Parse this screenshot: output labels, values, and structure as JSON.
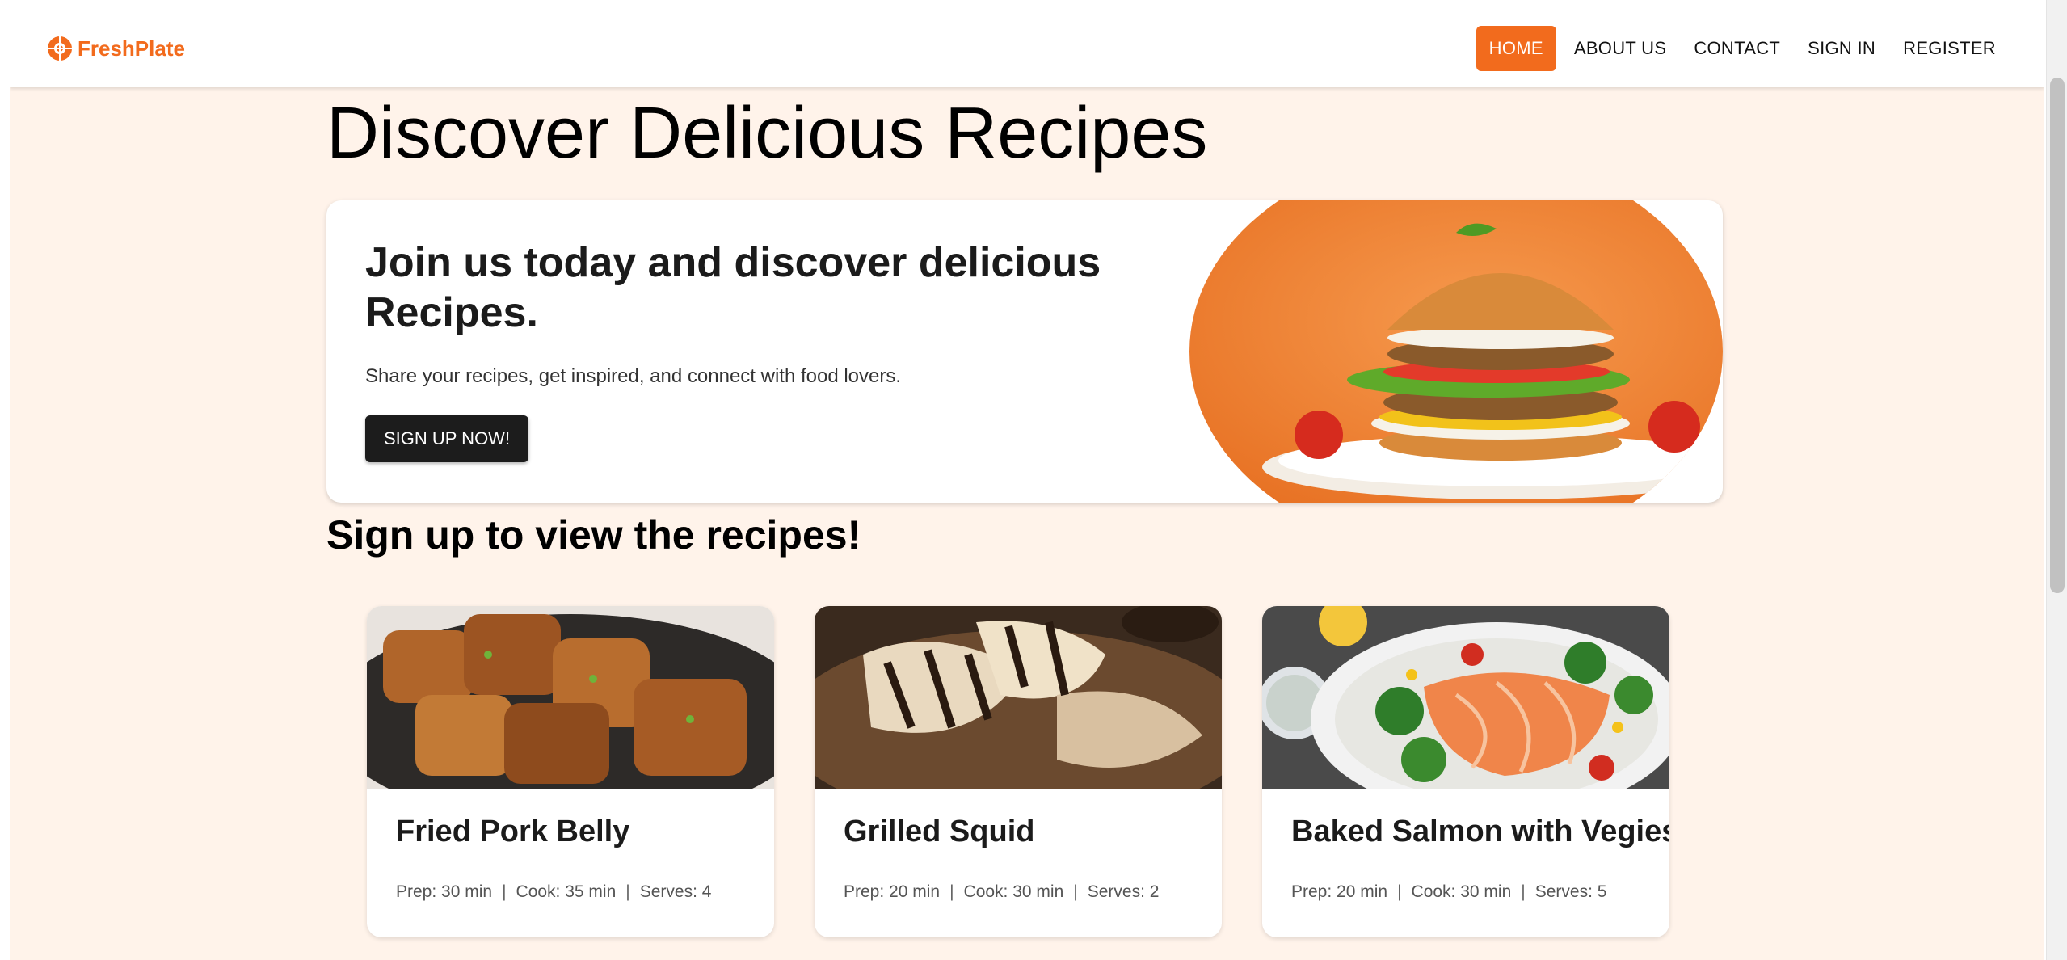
{
  "brand": {
    "name": "FreshPlate",
    "accent": "#f26b1d",
    "logo_icon": "plate-logo-icon"
  },
  "nav": {
    "items": [
      {
        "label": "HOME",
        "active": true
      },
      {
        "label": "ABOUT US",
        "active": false
      },
      {
        "label": "CONTACT",
        "active": false
      },
      {
        "label": "SIGN IN",
        "active": false
      },
      {
        "label": "REGISTER",
        "active": false
      }
    ]
  },
  "hero": {
    "title": "Discover Delicious Recipes",
    "heading": "Join us today and discover delicious Recipes.",
    "subtext": "Share your recipes, get inspired, and connect with food lovers.",
    "cta_label": "SIGN UP NOW!",
    "image": "burger-image"
  },
  "recipes_section": {
    "title": "Sign up to view the recipes!"
  },
  "recipes": [
    {
      "title": "Fried Pork Belly",
      "prep": "Prep: 30 min",
      "cook": "Cook: 35 min",
      "serves": "Serves: 4",
      "image": "fried-pork-belly-image"
    },
    {
      "title": "Grilled Squid",
      "prep": "Prep: 20 min",
      "cook": "Cook: 30 min",
      "serves": "Serves: 2",
      "image": "grilled-squid-image"
    },
    {
      "title": "Baked Salmon with Vegies",
      "prep": "Prep: 20 min",
      "cook": "Cook: 30 min",
      "serves": "Serves: 5",
      "image": "baked-salmon-image"
    }
  ],
  "colors": {
    "page_bg": "#fff3ea",
    "button_dark": "#1c1c1c"
  }
}
